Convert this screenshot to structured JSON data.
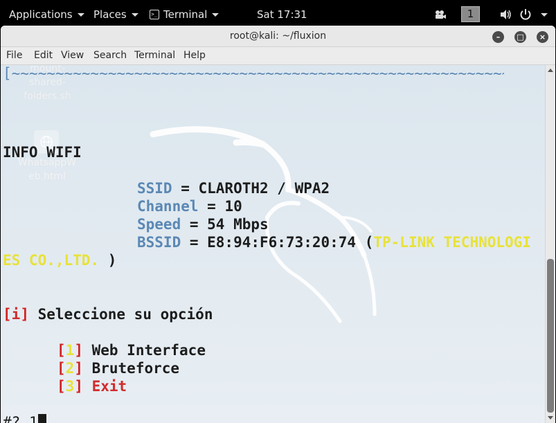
{
  "topbar": {
    "applications": "Applications",
    "places": "Places",
    "terminal": "Terminal",
    "clock": "Sat 17:31",
    "workspace": "1",
    "icons": [
      "terminal-app-icon",
      "video-icon",
      "volume-icon",
      "power-icon"
    ]
  },
  "window": {
    "title": "root@kali: ~/fluxion",
    "buttons": [
      "minimize",
      "maximize",
      "close"
    ]
  },
  "menubar": {
    "file": "File",
    "edit": "Edit",
    "view": "View",
    "search": "Search",
    "terminal": "Terminal",
    "help": "Help"
  },
  "desktop": {
    "icon1_label_l1": "mount-",
    "icon1_label_l2": "shared-",
    "icon1_label_l3": "folders.sh",
    "icon2_label_l1": "WhatsappW",
    "icon2_label_l2": "eb.html"
  },
  "terminal": {
    "border_line": "[~~~~~~~~~~~~~~~~~~~~~~~~~~~~~~~~~~~~~~~~~~~~~~~~~~~~~~~~~~~~~~~~~~~~~~~~~~~~~~~~~~~~~~~~~~~~~~~]",
    "info_header": "INFO WIFI",
    "ssid_key": "SSID",
    "ssid_val": " = CLAROTH2 / WPA2",
    "channel_key": "Channel",
    "channel_val": " = 10",
    "speed_key": "Speed",
    "speed_val": " = 54 Mbps",
    "bssid_key": "BSSID",
    "bssid_val": " = E8:94:F6:73:20:74 (",
    "vendor_part1": "TP-LINK TECHNOLOGI",
    "vendor_part2": "ES CO.,LTD.",
    "vendor_close": " )",
    "prompt_marker": "i",
    "prompt_text": " Seleccione su opción",
    "options": [
      {
        "num": "1",
        "label": " Web Interface"
      },
      {
        "num": "2",
        "label": " Bruteforce"
      },
      {
        "num": "3",
        "label": " Exit"
      }
    ],
    "input_prompt": "#? ",
    "input_value": "1"
  },
  "colors": {
    "accent_blue": "#5b88b5",
    "yellow": "#e8e23a",
    "red": "#d12b2b"
  }
}
